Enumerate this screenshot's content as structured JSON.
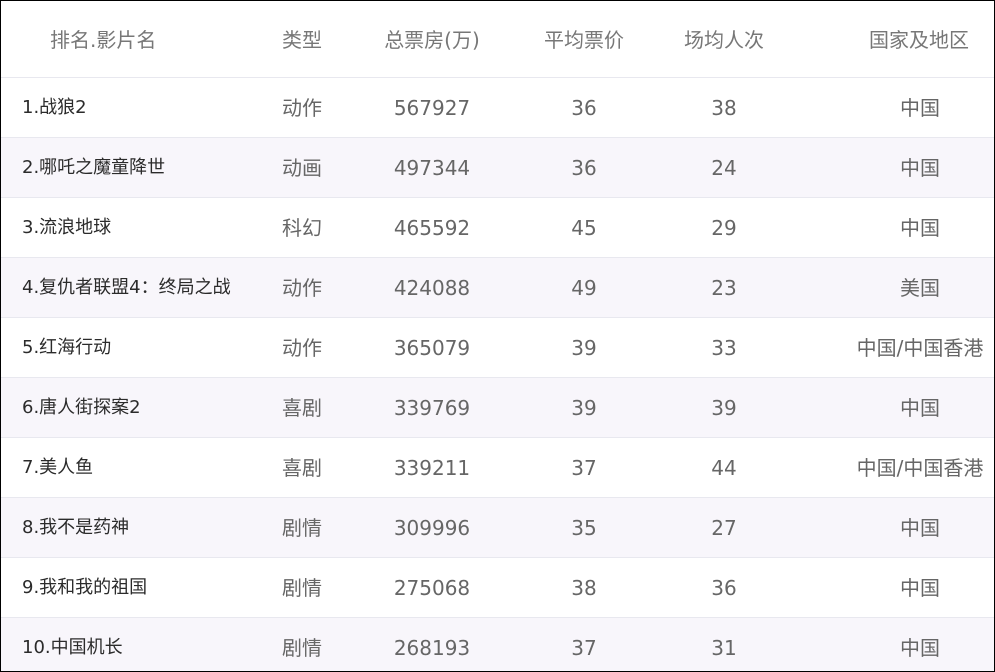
{
  "header": {
    "rank_name": "排名.影片名",
    "genre": "类型",
    "box_office": "总票房(万)",
    "avg_price": "平均票价",
    "avg_attendance": "场均人次",
    "region": "国家及地区"
  },
  "rows": [
    {
      "name": "1.战狼2",
      "genre": "动作",
      "box": "567927",
      "price": "36",
      "people": "38",
      "region": "中国"
    },
    {
      "name": "2.哪吒之魔童降世",
      "genre": "动画",
      "box": "497344",
      "price": "36",
      "people": "24",
      "region": "中国"
    },
    {
      "name": "3.流浪地球",
      "genre": "科幻",
      "box": "465592",
      "price": "45",
      "people": "29",
      "region": "中国"
    },
    {
      "name": "4.复仇者联盟4：终局之战",
      "genre": "动作",
      "box": "424088",
      "price": "49",
      "people": "23",
      "region": "美国"
    },
    {
      "name": "5.红海行动",
      "genre": "动作",
      "box": "365079",
      "price": "39",
      "people": "33",
      "region": "中国/中国香港"
    },
    {
      "name": "6.唐人街探案2",
      "genre": "喜剧",
      "box": "339769",
      "price": "39",
      "people": "39",
      "region": "中国"
    },
    {
      "name": "7.美人鱼",
      "genre": "喜剧",
      "box": "339211",
      "price": "37",
      "people": "44",
      "region": "中国/中国香港"
    },
    {
      "name": "8.我不是药神",
      "genre": "剧情",
      "box": "309996",
      "price": "35",
      "people": "27",
      "region": "中国"
    },
    {
      "name": "9.我和我的祖国",
      "genre": "剧情",
      "box": "275068",
      "price": "38",
      "people": "36",
      "region": "中国"
    },
    {
      "name": "10.中国机长",
      "genre": "剧情",
      "box": "268193",
      "price": "37",
      "people": "31",
      "region": "中国"
    }
  ]
}
